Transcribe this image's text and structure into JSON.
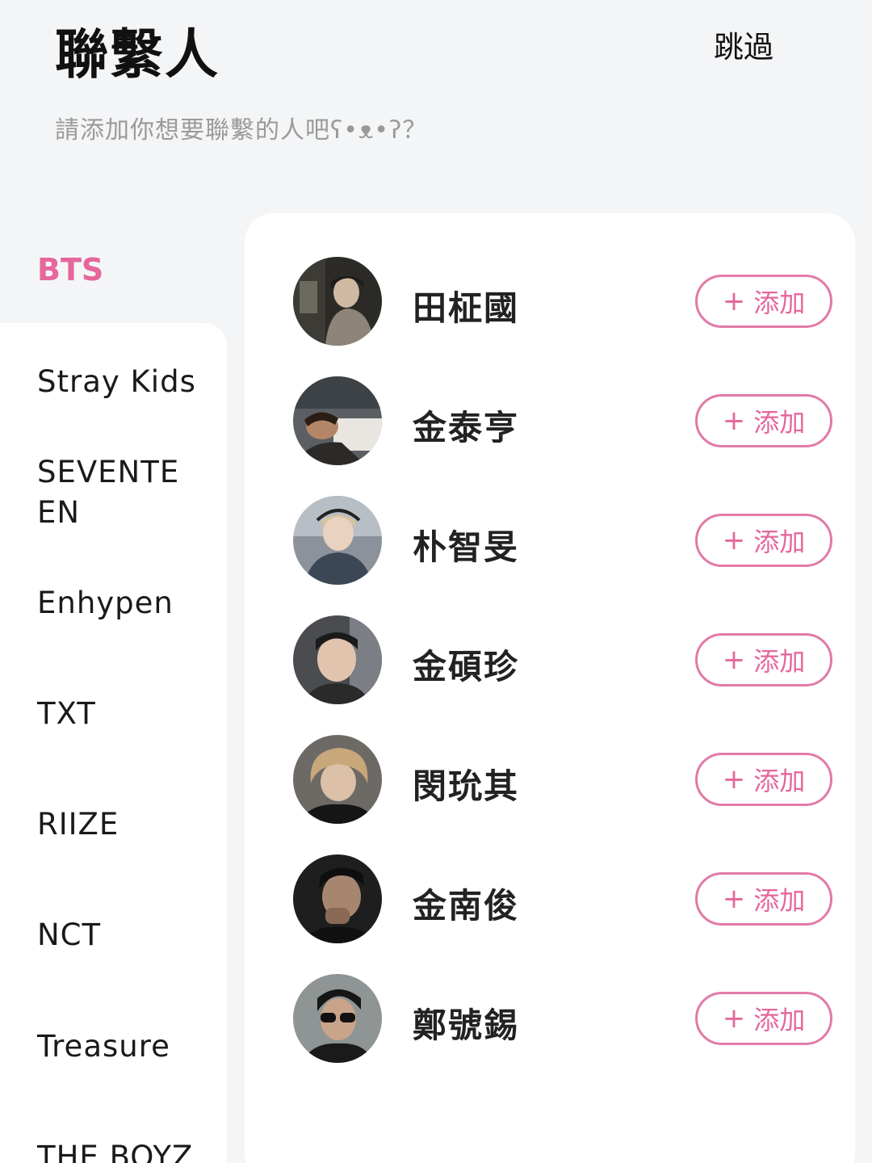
{
  "header": {
    "title": "聯繫人",
    "skip_label": "跳過",
    "subtitle": "請添加你想要聯繫的人吧ʕ•ᴥ•ʔ？"
  },
  "sidebar": {
    "active": "BTS",
    "items": [
      {
        "label": "Stray Kids"
      },
      {
        "label": "SEVENTEEN"
      },
      {
        "label": "Enhypen"
      },
      {
        "label": "TXT"
      },
      {
        "label": "RIIZE"
      },
      {
        "label": "NCT"
      },
      {
        "label": "Treasure"
      },
      {
        "label": "THE BOYZ"
      }
    ]
  },
  "members": [
    {
      "name": "田柾國",
      "add_label": "添加",
      "icon": "plus-icon"
    },
    {
      "name": "金泰亨",
      "add_label": "添加",
      "icon": "plus-icon"
    },
    {
      "name": "朴智旻",
      "add_label": "添加",
      "icon": "plus-icon"
    },
    {
      "name": "金碩珍",
      "add_label": "添加",
      "icon": "plus-icon"
    },
    {
      "name": "閔玧其",
      "add_label": "添加",
      "icon": "plus-icon"
    },
    {
      "name": "金南俊",
      "add_label": "添加",
      "icon": "plus-icon"
    },
    {
      "name": "鄭號錫",
      "add_label": "添加",
      "icon": "plus-icon"
    }
  ],
  "colors": {
    "accent": "#e5679c",
    "background": "#f4f5f7",
    "card": "#ffffff"
  }
}
